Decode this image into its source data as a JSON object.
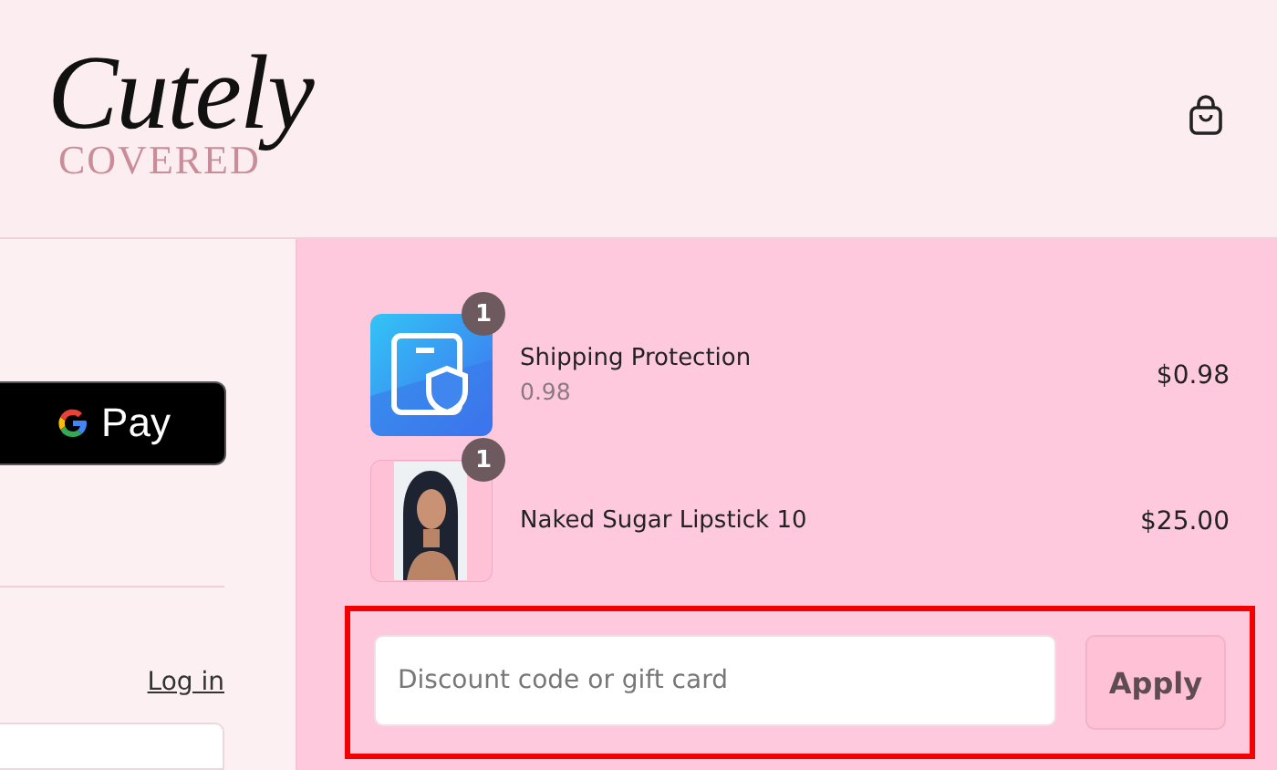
{
  "header": {
    "logo": {
      "script": "Cutely",
      "subtitle": "COVERED"
    }
  },
  "express_checkout": {
    "button": "Pay"
  },
  "account": {
    "link": "Log in"
  },
  "cart": {
    "items": [
      {
        "kind": "icon",
        "quantity": "1",
        "name": "Shipping Protection",
        "variant": "0.98",
        "price": "$0.98"
      },
      {
        "kind": "picture",
        "quantity": "1",
        "name": "Naked Sugar Lipstick 10",
        "price": "$25.00"
      }
    ]
  },
  "discount": {
    "placeholder": "Discount code or gift card",
    "button": "Apply",
    "highlighted": true
  }
}
